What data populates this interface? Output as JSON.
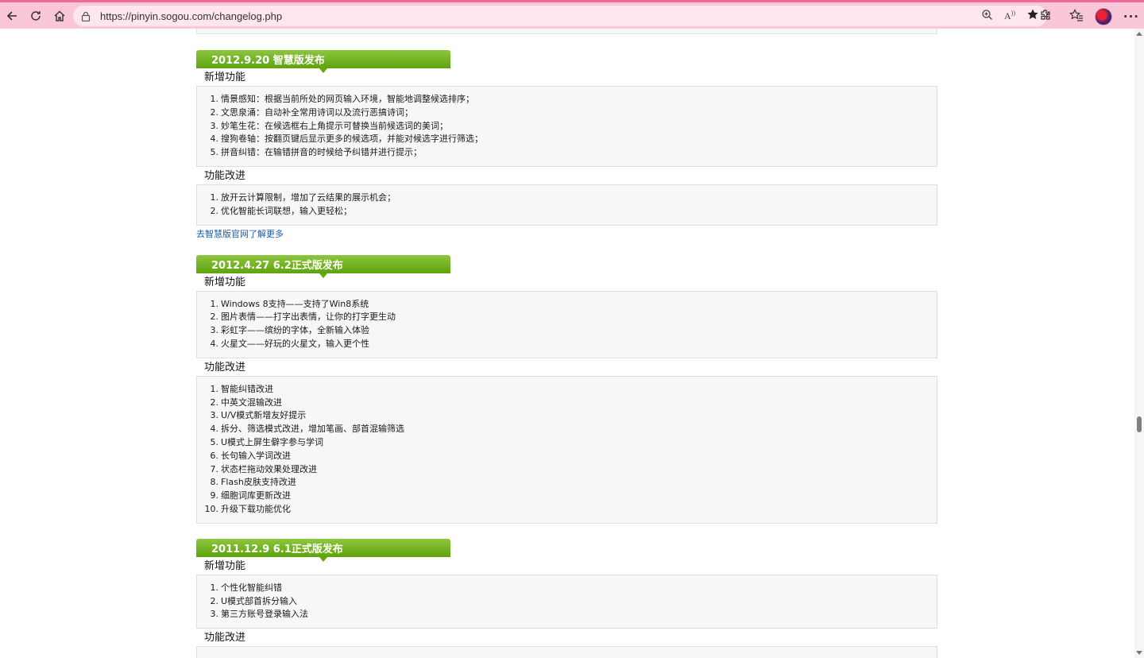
{
  "browser": {
    "url": "https://pinyin.sogou.com/changelog.php",
    "icons": [
      "back-icon",
      "refresh-icon",
      "home-icon",
      "lock-icon",
      "zoom-icon",
      "read-aloud-icon",
      "favorite-star-icon",
      "extensions-icon",
      "favorites-list-icon",
      "avatar",
      "more-icon"
    ],
    "accent": "#f06a9c"
  },
  "releases": [
    {
      "title": "2012.9.20 智慧版发布",
      "new_label": "新增功能",
      "new_items": [
        "情景感知：根据当前所处的网页输入环境，智能地调整候选排序；",
        "文思泉涌：自动补全常用诗词以及流行恶搞诗词；",
        "妙笔生花：在候选框右上角提示可替换当前候选词的美词；",
        "搜狗卷轴：按翻页键后显示更多的候选项，并能对候选字进行筛选；",
        "拼音纠错：在输错拼音的时候给予纠错并进行提示；"
      ],
      "improve_label": "功能改进",
      "improve_items": [
        "放开云计算限制，增加了云结果的展示机会；",
        "优化智能长词联想，输入更轻松；"
      ],
      "link": "去智慧版官网了解更多"
    },
    {
      "title": "2012.4.27 6.2正式版发布",
      "new_label": "新增功能",
      "new_items": [
        "Windows 8支持——支持了Win8系统",
        "图片表情——打字出表情，让你的打字更生动",
        "彩虹字——缤纷的字体，全新输入体验",
        "火星文——好玩的火星文，输入更个性"
      ],
      "improve_label": "功能改进",
      "improve_items": [
        "智能纠错改进",
        "中英文混输改进",
        "U/V模式新增友好提示",
        "拆分、筛选模式改进，增加笔画、部首混输筛选",
        "U模式上屏生僻字参与学词",
        "长句输入学词改进",
        "状态栏拖动效果处理改进",
        "Flash皮肤支持改进",
        "细胞词库更新改进",
        "升级下载功能优化"
      ]
    },
    {
      "title": "2011.12.9 6.1正式版发布",
      "new_label": "新增功能",
      "new_items": [
        "个性化智能纠错",
        "U模式部首拆分输入",
        "第三方账号登录输入法"
      ],
      "improve_label": "功能改进",
      "improve_items": []
    }
  ]
}
